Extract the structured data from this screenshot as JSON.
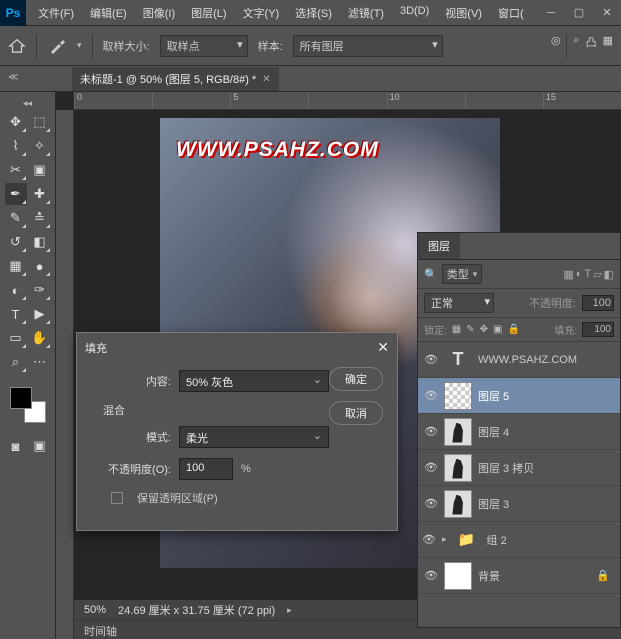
{
  "menu": {
    "file": "文件(F)",
    "edit": "编辑(E)",
    "image": "图像(I)",
    "layer": "图层(L)",
    "type": "文字(Y)",
    "select": "选择(S)",
    "filter": "滤镜(T)",
    "3d": "3D(D)",
    "view": "视图(V)",
    "window": "窗口("
  },
  "optbar": {
    "sample_size_label": "取样大小:",
    "sample_size_value": "取样点",
    "sample_label": "样本:",
    "sample_value": "所有图层"
  },
  "doc_tab": "未标题-1 @ 50% (图层 5, RGB/8#) *",
  "ruler": {
    "marks": [
      "0",
      "",
      "5",
      "",
      "10",
      "",
      "15"
    ]
  },
  "watermark": "WWW.PSAHZ.COM",
  "dialog": {
    "title": "填充",
    "content_label": "内容:",
    "content_value": "50% 灰色",
    "blend_section": "混合",
    "mode_label": "模式:",
    "mode_value": "柔光",
    "opacity_label": "不透明度(O):",
    "opacity_value": "100",
    "opacity_unit": "%",
    "preserve": "保留透明区域(P)",
    "ok": "确定",
    "cancel": "取消"
  },
  "layers_panel": {
    "tab": "图层",
    "kind_label": "类型",
    "blend_mode": "正常",
    "opacity_label": "不透明度:",
    "opacity_value": "100",
    "lock_label": "锁定:",
    "fill_label": "填充:",
    "fill_value": "100",
    "layers": [
      {
        "name": "WWW.PSAHZ.COM",
        "type": "T"
      },
      {
        "name": "图层 5",
        "type": "checker",
        "sel": true
      },
      {
        "name": "图层 4",
        "type": "dark"
      },
      {
        "name": "图层 3 拷贝",
        "type": "dark"
      },
      {
        "name": "图层 3",
        "type": "dark"
      },
      {
        "name": "组 2",
        "type": "folder"
      },
      {
        "name": "背景",
        "type": "white",
        "locked": true
      }
    ]
  },
  "status": {
    "zoom": "50%",
    "dims": "24.69 厘米 x 31.75 厘米 (72 ppi)",
    "timeline": "时间轴"
  }
}
